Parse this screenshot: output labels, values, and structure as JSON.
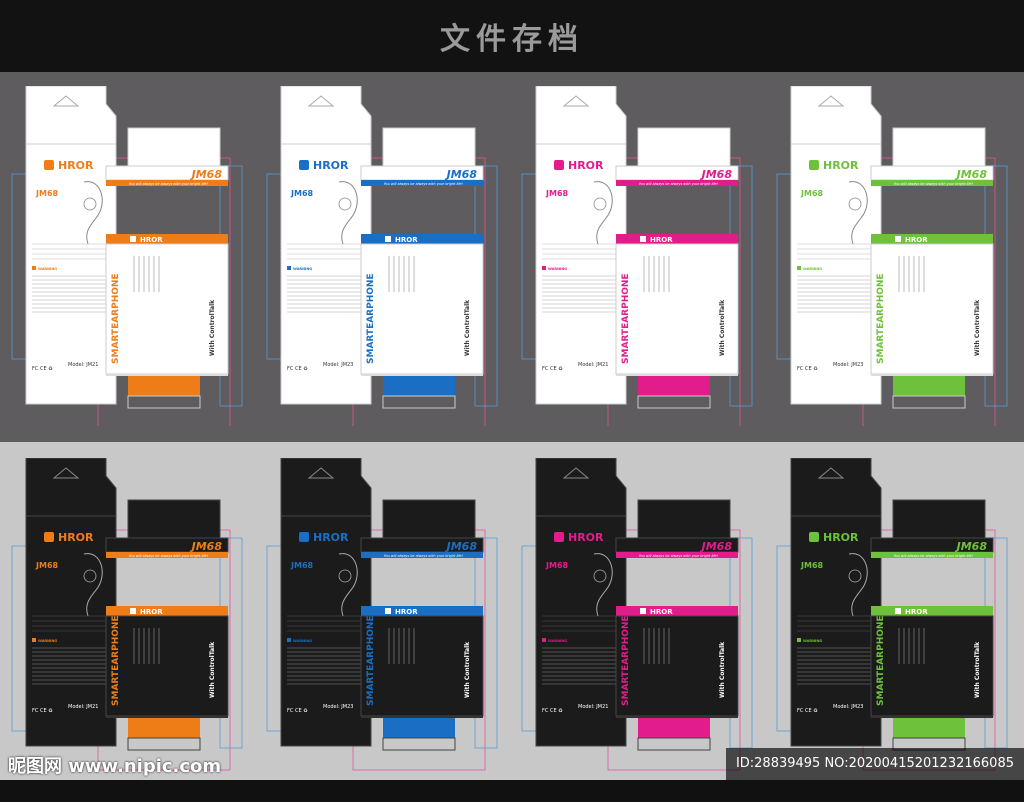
{
  "header": {
    "title": "文件存档"
  },
  "brand": "HROR",
  "model_code": "JM68",
  "product_line1": "SMARTEARPHONE",
  "control_text": "With ControlTalk",
  "tagline": "You will always be always with your bright life!",
  "warning_label": "WARNING",
  "packages": [
    {
      "variant": "light",
      "accent": "#ef7d17",
      "model": "Model: JM21"
    },
    {
      "variant": "light",
      "accent": "#1a6fc4",
      "model": "Model: JM23"
    },
    {
      "variant": "light",
      "accent": "#e21c8b",
      "model": "Model: JM21"
    },
    {
      "variant": "light",
      "accent": "#6ec13a",
      "model": "Model: JM23"
    },
    {
      "variant": "dark",
      "accent": "#ef7d17",
      "model": "Model: JM21"
    },
    {
      "variant": "dark",
      "accent": "#1a6fc4",
      "model": "Model: JM23"
    },
    {
      "variant": "dark",
      "accent": "#e21c8b",
      "model": "Model: JM21"
    },
    {
      "variant": "dark",
      "accent": "#6ec13a",
      "model": "Model: JM23"
    }
  ],
  "footer": {
    "left_watermark": "昵图网 www.nipic.com",
    "right_watermark": "ID:28839495 NO:20200415201232166085"
  }
}
